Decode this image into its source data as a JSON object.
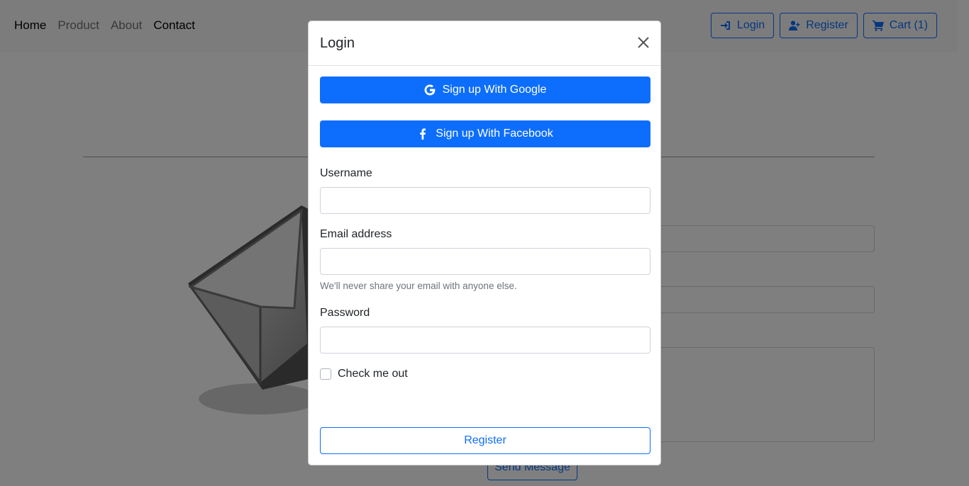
{
  "nav": {
    "links": [
      "Home",
      "Product",
      "About",
      "Contact"
    ],
    "buttons": {
      "login": "Login",
      "register": "Register",
      "cart": "Cart (1)"
    }
  },
  "background": {
    "send_button": "Send Message"
  },
  "modal": {
    "title": "Login",
    "google_button": "Sign up With Google",
    "facebook_button": "Sign up With Facebook",
    "username_label": "Username",
    "email_label": "Email address",
    "email_help": "We'll never share your email with anyone else.",
    "password_label": "Password",
    "checkbox_label": "Check me out",
    "submit_button": "Register"
  },
  "colors": {
    "primary": "#0d6efd",
    "backdrop": "rgba(0,0,0,0.5)"
  }
}
